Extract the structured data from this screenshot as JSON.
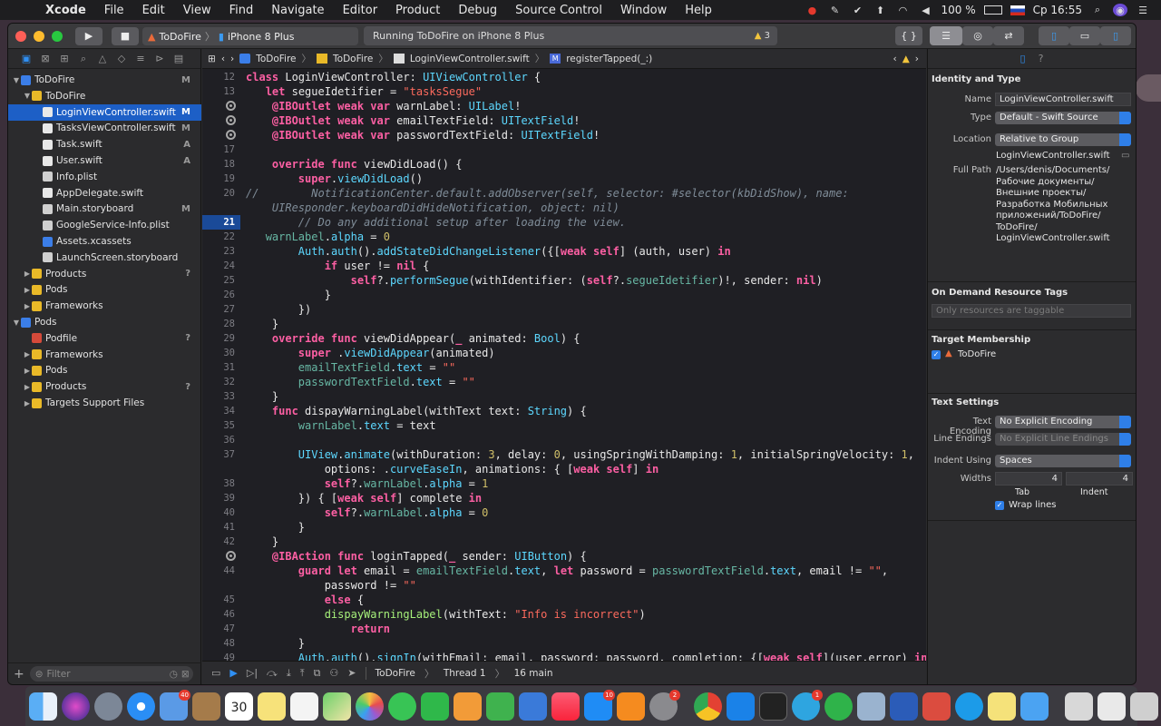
{
  "menubar": {
    "items": [
      "Xcode",
      "File",
      "Edit",
      "View",
      "Find",
      "Navigate",
      "Editor",
      "Product",
      "Debug",
      "Source Control",
      "Window",
      "Help"
    ],
    "battery": "100 %",
    "clock": "Ср 16:55"
  },
  "toolbar": {
    "scheme_target": "ToDoFire",
    "scheme_device": "iPhone 8 Plus",
    "activity": "Running ToDoFire on iPhone 8 Plus",
    "warnings": "3",
    "braces": "{ }"
  },
  "navigator": {
    "items": [
      {
        "label": "ToDoFire",
        "status": "M",
        "depth": 0,
        "icon": "blue",
        "tri": "▼"
      },
      {
        "label": "ToDoFire",
        "status": "",
        "depth": 1,
        "icon": "folder",
        "tri": "▼"
      },
      {
        "label": "LoginViewController.swift",
        "status": "M",
        "depth": 2,
        "icon": "swift",
        "tri": "",
        "selected": true
      },
      {
        "label": "TasksViewController.swift",
        "status": "M",
        "depth": 2,
        "icon": "swift",
        "tri": ""
      },
      {
        "label": "Task.swift",
        "status": "A",
        "depth": 2,
        "icon": "swift",
        "tri": ""
      },
      {
        "label": "User.swift",
        "status": "A",
        "depth": 2,
        "icon": "swift",
        "tri": ""
      },
      {
        "label": "Info.plist",
        "status": "",
        "depth": 2,
        "icon": "story",
        "tri": ""
      },
      {
        "label": "AppDelegate.swift",
        "status": "",
        "depth": 2,
        "icon": "swift",
        "tri": ""
      },
      {
        "label": "Main.storyboard",
        "status": "M",
        "depth": 2,
        "icon": "story",
        "tri": ""
      },
      {
        "label": "GoogleService-Info.plist",
        "status": "",
        "depth": 2,
        "icon": "story",
        "tri": ""
      },
      {
        "label": "Assets.xcassets",
        "status": "",
        "depth": 2,
        "icon": "blue",
        "tri": ""
      },
      {
        "label": "LaunchScreen.storyboard",
        "status": "",
        "depth": 2,
        "icon": "story",
        "tri": ""
      },
      {
        "label": "Products",
        "status": "?",
        "depth": 1,
        "icon": "folder",
        "tri": "▶"
      },
      {
        "label": "Pods",
        "status": "",
        "depth": 1,
        "icon": "folder",
        "tri": "▶"
      },
      {
        "label": "Frameworks",
        "status": "",
        "depth": 1,
        "icon": "folder",
        "tri": "▶"
      },
      {
        "label": "Pods",
        "status": "",
        "depth": 0,
        "icon": "blue",
        "tri": "▼"
      },
      {
        "label": "Podfile",
        "status": "?",
        "depth": 1,
        "icon": "pod",
        "tri": ""
      },
      {
        "label": "Frameworks",
        "status": "",
        "depth": 1,
        "icon": "folder",
        "tri": "▶"
      },
      {
        "label": "Pods",
        "status": "",
        "depth": 1,
        "icon": "folder",
        "tri": "▶"
      },
      {
        "label": "Products",
        "status": "?",
        "depth": 1,
        "icon": "folder",
        "tri": "▶"
      },
      {
        "label": "Targets Support Files",
        "status": "",
        "depth": 1,
        "icon": "folder",
        "tri": "▶"
      }
    ],
    "filter_placeholder": "Filter"
  },
  "jumpbar": {
    "crumbs": [
      "ToDoFire",
      "ToDoFire",
      "LoginViewController.swift",
      "registerTapped(_:)"
    ]
  },
  "editor": {
    "current_line": "21",
    "lines": [
      {
        "n": "12",
        "bp": false,
        "h": "<span class=k>class</span> LoginViewController: <span class=t>UIViewController</span> {"
      },
      {
        "n": "13",
        "bp": false,
        "h": "   <span class=k>let</span> segueIdetifier = <span class=s>\"tasksSegue\"</span>"
      },
      {
        "n": "",
        "bp": true,
        "h": "    <span class=k>@IBOutlet weak var</span> warnLabel: <span class=t>UILabel</span>!"
      },
      {
        "n": "",
        "bp": true,
        "h": "    <span class=k>@IBOutlet weak var</span> emailTextField: <span class=t>UITextField</span>!"
      },
      {
        "n": "",
        "bp": true,
        "h": "    <span class=k>@IBOutlet weak var</span> passwordTextField: <span class=t>UITextField</span>!"
      },
      {
        "n": "17",
        "bp": false,
        "h": ""
      },
      {
        "n": "18",
        "bp": false,
        "h": "    <span class=k>override func</span> viewDidLoad() {"
      },
      {
        "n": "19",
        "bp": false,
        "h": "        <span class=k>super</span>.<span class=t>viewDidLoad</span>()"
      },
      {
        "n": "20",
        "bp": false,
        "h": "<span class=c>//        NotificationCenter.default.addObserver(self, selector: #selector(kbDidShow), name:</span>"
      },
      {
        "n": "",
        "bp": false,
        "h": "<span class=c>    UIResponder.keyboardDidHideNotification, object: nil)</span>"
      },
      {
        "n": "21",
        "bp": false,
        "h": "<span class=c>        // Do any additional setup after loading the view.</span>"
      },
      {
        "n": "22",
        "bp": false,
        "h": "   <span class=a>warnLabel</span>.<span class=t>alpha</span> = <span class=n>0</span>"
      },
      {
        "n": "23",
        "bp": false,
        "h": "        <span class=t>Auth</span>.<span class=t>auth</span>().<span class=t>addStateDidChangeListener</span>({[<span class=k>weak self</span>] (auth, user) <span class=k>in</span>"
      },
      {
        "n": "24",
        "bp": false,
        "h": "            <span class=k>if</span> user != <span class=k>nil</span> {"
      },
      {
        "n": "25",
        "bp": false,
        "h": "                <span class=k>self</span>?.<span class=t>performSegue</span>(withIdentifier: (<span class=k>self</span>?.<span class=a>segueIdetifier</span>)!, sender: <span class=k>nil</span>)"
      },
      {
        "n": "26",
        "bp": false,
        "h": "            }"
      },
      {
        "n": "27",
        "bp": false,
        "h": "        })"
      },
      {
        "n": "28",
        "bp": false,
        "h": "    }"
      },
      {
        "n": "29",
        "bp": false,
        "h": "    <span class=k>override func</span> viewDidAppear(<span class=k>_</span> animated: <span class=t>Bool</span>) {"
      },
      {
        "n": "30",
        "bp": false,
        "h": "        <span class=k>super</span> .<span class=t>viewDidAppear</span>(animated)"
      },
      {
        "n": "31",
        "bp": false,
        "h": "        <span class=a>emailTextField</span>.<span class=t>text</span> = <span class=s>\"\"</span>"
      },
      {
        "n": "32",
        "bp": false,
        "h": "        <span class=a>passwordTextField</span>.<span class=t>text</span> = <span class=s>\"\"</span>"
      },
      {
        "n": "33",
        "bp": false,
        "h": "    }"
      },
      {
        "n": "34",
        "bp": false,
        "h": "    <span class=k>func</span> dispayWarningLabel(withText text: <span class=t>String</span>) {"
      },
      {
        "n": "35",
        "bp": false,
        "h": "        <span class=a>warnLabel</span>.<span class=t>text</span> = text"
      },
      {
        "n": "36",
        "bp": false,
        "h": ""
      },
      {
        "n": "37",
        "bp": false,
        "h": "        <span class=t>UIView</span>.<span class=t>animate</span>(withDuration: <span class=n>3</span>, delay: <span class=n>0</span>, usingSpringWithDamping: <span class=n>1</span>, initialSpringVelocity: <span class=n>1</span>,"
      },
      {
        "n": "",
        "bp": false,
        "h": "            options: .<span class=t>curveEaseIn</span>, animations: { [<span class=k>weak self</span>] <span class=k>in</span>"
      },
      {
        "n": "38",
        "bp": false,
        "h": "            <span class=k>self</span>?.<span class=a>warnLabel</span>.<span class=t>alpha</span> = <span class=n>1</span>"
      },
      {
        "n": "39",
        "bp": false,
        "h": "        }) { [<span class=k>weak self</span>] complete <span class=k>in</span>"
      },
      {
        "n": "40",
        "bp": false,
        "h": "            <span class=k>self</span>?.<span class=a>warnLabel</span>.<span class=t>alpha</span> = <span class=n>0</span>"
      },
      {
        "n": "41",
        "bp": false,
        "h": "        }"
      },
      {
        "n": "42",
        "bp": false,
        "h": "    }"
      },
      {
        "n": "",
        "bp": true,
        "h": "    <span class=k>@IBAction func</span> loginTapped(<span class=k>_</span> sender: <span class=t>UIButton</span>) {"
      },
      {
        "n": "44",
        "bp": false,
        "h": "        <span class=k>guard let</span> email = <span class=a>emailTextField</span>.<span class=t>text</span>, <span class=k>let</span> password = <span class=a>passwordTextField</span>.<span class=t>text</span>, email != <span class=s>\"\"</span>,"
      },
      {
        "n": "",
        "bp": false,
        "h": "            password != <span class=s>\"\"</span>"
      },
      {
        "n": "45",
        "bp": false,
        "h": "            <span class=k>else</span> {"
      },
      {
        "n": "46",
        "bp": false,
        "h": "            <span class=p>dispayWarningLabel</span>(withText: <span class=s>\"Info is incorrect\"</span>)"
      },
      {
        "n": "47",
        "bp": false,
        "h": "                <span class=k>return</span>"
      },
      {
        "n": "48",
        "bp": false,
        "h": "        }"
      },
      {
        "n": "49",
        "bp": false,
        "h": "        <span class=t>Auth</span>.<span class=t>auth</span>().<span class=t>signIn</span>(withEmail: email, password: password, completion: {[<span class=k>weak self</span>](user,error) <span class=k>in</span>"
      }
    ]
  },
  "debugbar": {
    "target": "ToDoFire",
    "thread": "Thread 1",
    "frame": "16 main"
  },
  "inspector": {
    "identity_header": "Identity and Type",
    "name_label": "Name",
    "name_value": "LoginViewController.swift",
    "type_label": "Type",
    "type_value": "Default - Swift Source",
    "location_label": "Location",
    "location_value": "Relative to Group",
    "location_file": "LoginViewController.swift",
    "fullpath_label": "Full Path",
    "fullpath_lines": [
      "/Users/denis/Documents/",
      "Рабочие документы/",
      "Внешние проекты/",
      "Разработка Мобильных",
      "приложений/ToDoFire/",
      "ToDoFire/",
      "LoginViewController.swift"
    ],
    "ondemand_header": "On Demand Resource Tags",
    "ondemand_placeholder": "Only resources are taggable",
    "target_header": "Target Membership",
    "target_item": "ToDoFire",
    "text_header": "Text Settings",
    "encoding_label": "Text Encoding",
    "encoding_value": "No Explicit Encoding",
    "endings_label": "Line Endings",
    "endings_value": "No Explicit Line Endings",
    "indent_label": "Indent Using",
    "indent_value": "Spaces",
    "widths_label": "Widths",
    "tab_value": "4",
    "indent_width_value": "4",
    "tab_label": "Tab",
    "indent_label2": "Indent",
    "wrap_label": "Wrap lines"
  },
  "dock": {
    "badges": {
      "calendar": "30",
      "mail": "40",
      "appstore": "10",
      "prefs": "2",
      "telegram": "1"
    }
  }
}
